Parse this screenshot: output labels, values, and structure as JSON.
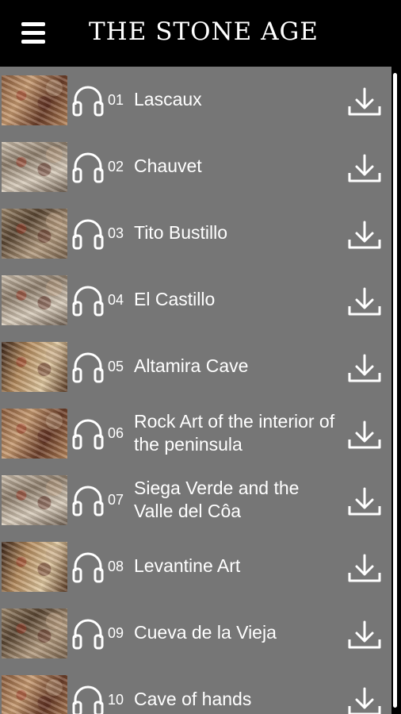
{
  "app": {
    "title": "THE STONE AGE"
  },
  "tracks": [
    {
      "number": "01",
      "title": "Lascaux"
    },
    {
      "number": "02",
      "title": "Chauvet"
    },
    {
      "number": "03",
      "title": "Tito Bustillo"
    },
    {
      "number": "04",
      "title": "El Castillo"
    },
    {
      "number": "05",
      "title": "Altamira Cave"
    },
    {
      "number": "06",
      "title": "Rock Art of the interior of the peninsula"
    },
    {
      "number": "07",
      "title": "Siega Verde and the Valle del Côa"
    },
    {
      "number": "08",
      "title": "Levantine Art"
    },
    {
      "number": "09",
      "title": "Cueva de la Vieja"
    },
    {
      "number": "10",
      "title": "Cave of hands"
    }
  ],
  "icons": {
    "menu": "hamburger-menu-icon",
    "play": "headphones-icon",
    "download": "download-icon"
  },
  "colors": {
    "topbar": "#000000",
    "list_background": "#767676",
    "text": "#ffffff"
  }
}
